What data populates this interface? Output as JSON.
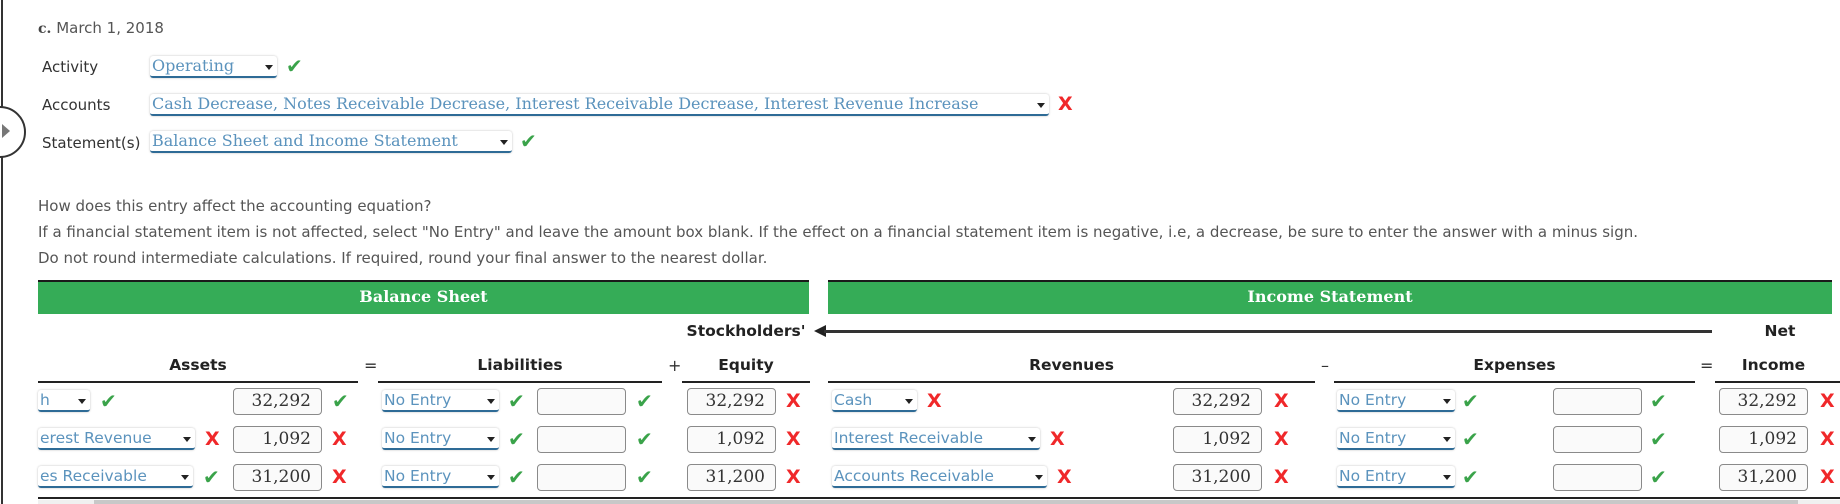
{
  "header": {
    "part_letter": "c.",
    "date": "March 1, 2018"
  },
  "fields": {
    "activity": {
      "label": "Activity",
      "value": "Operating",
      "status": "correct"
    },
    "accounts": {
      "label": "Accounts",
      "value": "Cash Decrease, Notes Receivable Decrease, Interest Receivable Decrease, Interest Revenue Increase",
      "status": "incorrect"
    },
    "statements": {
      "label": "Statement(s)",
      "value": "Balance Sheet and Income Statement",
      "status": "correct"
    }
  },
  "instructions": {
    "line1": "How does this entry affect the accounting equation?",
    "line2": "If a financial statement item is not affected, select \"No Entry\" and leave the amount box blank. If the effect on a financial statement item is negative, i.e, a decrease, be sure to enter the answer with a minus sign.",
    "line3": "Do not round intermediate calculations. If required, round your final answer to the nearest dollar."
  },
  "table": {
    "balance_sheet_title": "Balance Sheet",
    "income_statement_title": "Income Statement",
    "stockholders_label": "Stockholders'",
    "net_label": "Net",
    "columns": {
      "assets": "Assets",
      "liabilities": "Liabilities",
      "equity": "Equity",
      "revenues": "Revenues",
      "expenses": "Expenses",
      "income": "Income"
    },
    "operators": {
      "eq1": "=",
      "plus": "+",
      "minus": "–",
      "eq2": "="
    },
    "rows": [
      {
        "asset_account": "Cash",
        "asset_account_visible": "h",
        "asset_account_status": "correct",
        "asset_amount": "32,292",
        "asset_amount_status": "correct",
        "liability_account": "No Entry",
        "liability_account_status": "correct",
        "liability_amount": "",
        "liability_amount_status": "correct",
        "equity_amount": "32,292",
        "equity_amount_status": "incorrect",
        "revenue_account": "Cash",
        "revenue_account_status": "incorrect",
        "revenue_amount": "32,292",
        "revenue_amount_status": "incorrect",
        "expense_account": "No Entry",
        "expense_account_status": "correct",
        "expense_amount": "",
        "expense_amount_status": "correct",
        "net_income": "32,292",
        "net_income_status": "incorrect"
      },
      {
        "asset_account": "Interest Revenue",
        "asset_account_visible": "erest Revenue",
        "asset_account_status": "incorrect",
        "asset_amount": "1,092",
        "asset_amount_status": "incorrect",
        "liability_account": "No Entry",
        "liability_account_status": "correct",
        "liability_amount": "",
        "liability_amount_status": "correct",
        "equity_amount": "1,092",
        "equity_amount_status": "incorrect",
        "revenue_account": "Interest Receivable",
        "revenue_account_status": "incorrect",
        "revenue_amount": "1,092",
        "revenue_amount_status": "incorrect",
        "expense_account": "No Entry",
        "expense_account_status": "correct",
        "expense_amount": "",
        "expense_amount_status": "correct",
        "net_income": "1,092",
        "net_income_status": "incorrect"
      },
      {
        "asset_account": "Notes Receivable",
        "asset_account_visible": "es Receivable",
        "asset_account_status": "correct",
        "asset_amount": "31,200",
        "asset_amount_status": "incorrect",
        "liability_account": "No Entry",
        "liability_account_status": "correct",
        "liability_amount": "",
        "liability_amount_status": "correct",
        "equity_amount": "31,200",
        "equity_amount_status": "incorrect",
        "revenue_account": "Accounts Receivable",
        "revenue_account_status": "incorrect",
        "revenue_amount": "31,200",
        "revenue_amount_status": "incorrect",
        "expense_account": "No Entry",
        "expense_account_status": "correct",
        "expense_amount": "",
        "expense_amount_status": "correct",
        "net_income": "31,200",
        "net_income_status": "incorrect"
      }
    ]
  },
  "icons": {
    "correct": "✔",
    "incorrect": "X"
  },
  "colors": {
    "header_green": "#35ac57",
    "correct_green": "#3aa34a",
    "incorrect_red": "#f0282a",
    "link_blue": "#5b93bd"
  }
}
